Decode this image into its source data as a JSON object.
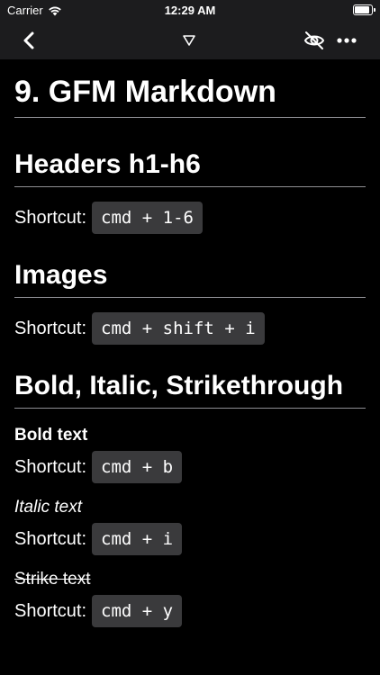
{
  "status_bar": {
    "carrier": "Carrier",
    "time": "12:29 AM"
  },
  "nav": {
    "back_icon": "chevron-left-icon",
    "filter_icon": "triangle-down-icon",
    "eye_icon": "eye-slash-icon",
    "more_icon": "ellipsis-icon"
  },
  "doc": {
    "title": "9. GFM Markdown",
    "sections": [
      {
        "heading": "Headers h1-h6",
        "shortcut_label": "Shortcut:",
        "shortcut": "cmd + 1-6"
      },
      {
        "heading": "Images",
        "shortcut_label": "Shortcut:",
        "shortcut": "cmd + shift + i"
      },
      {
        "heading": "Bold, Italic, Strikethrough"
      }
    ],
    "styles": [
      {
        "label": "Bold text",
        "shortcut_label": "Shortcut:",
        "shortcut": "cmd + b"
      },
      {
        "label": "Italic text",
        "shortcut_label": "Shortcut:",
        "shortcut": "cmd + i"
      },
      {
        "label": "Strike text",
        "shortcut_label": "Shortcut:",
        "shortcut": "cmd + y"
      }
    ]
  }
}
